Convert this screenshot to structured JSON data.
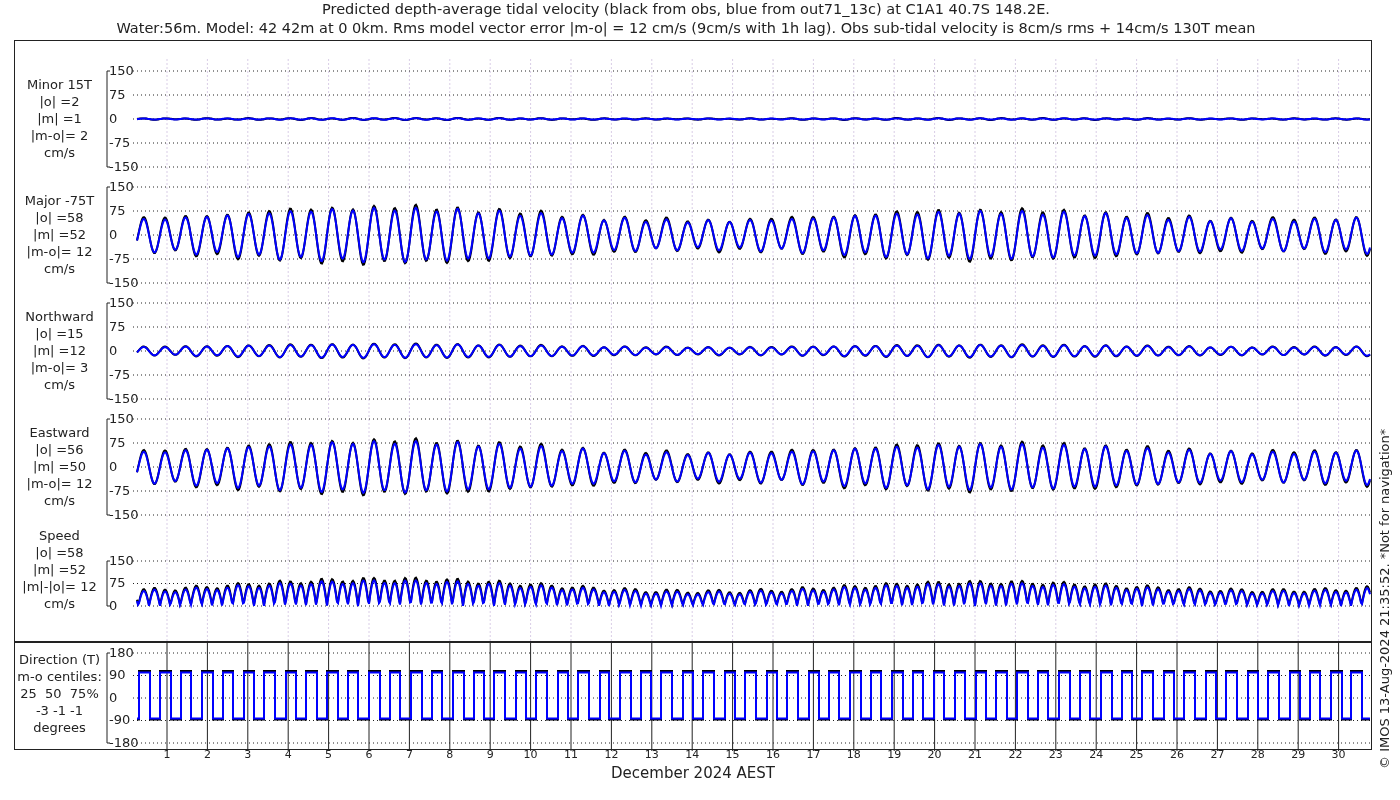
{
  "title": {
    "lines": [
      "Predicted depth-average tidal velocity (black from obs, blue from out71_13c) at C1A1 40.7S 148.2E.",
      "Water:56m. Model: 42 42m at 0 0km. Rms model vector error |m-o| = 12 cm/s (9cm/s with 1h lag). Obs sub-tidal velocity is 8cm/s rms + 14cm/s 130T mean"
    ]
  },
  "panels": [
    {
      "kind": "minor",
      "label_lines": [
        "Minor 15T",
        "|o| =2",
        "|m| =1",
        "|m-o|= 2",
        "cm/s"
      ],
      "yticks": [
        "150",
        "75",
        "0",
        "-75",
        "-150"
      ]
    },
    {
      "kind": "major",
      "label_lines": [
        "Major -75T",
        "|o| =58",
        "|m| =52",
        "|m-o|= 12",
        "cm/s"
      ],
      "yticks": [
        "150",
        "75",
        "0",
        "-75",
        "-150"
      ]
    },
    {
      "kind": "northward",
      "label_lines": [
        "Northward",
        "|o| =15",
        "|m| =12",
        "|m-o|= 3",
        "cm/s"
      ],
      "yticks": [
        "150",
        "75",
        "0",
        "-75",
        "-150"
      ]
    },
    {
      "kind": "eastward",
      "label_lines": [
        "Eastward",
        "|o| =56",
        "|m| =50",
        "|m-o|= 12",
        "cm/s"
      ],
      "yticks": [
        "150",
        "75",
        "0",
        "-75",
        "-150"
      ]
    },
    {
      "kind": "speed",
      "label_lines": [
        "Speed",
        "|o| =58",
        "|m| =52",
        "|m|-|o|= 12",
        "cm/s"
      ],
      "yticks": [
        "150",
        "75",
        "0"
      ]
    },
    {
      "kind": "direction",
      "label_lines": [
        "Direction (T)",
        "m-o centiles:",
        "25  50  75%",
        "-3 -1 -1",
        "degrees"
      ],
      "yticks": [
        "180",
        "90",
        "0",
        "-90",
        "-180"
      ]
    }
  ],
  "x_axis": {
    "days": [
      "1",
      "2",
      "3",
      "4",
      "5",
      "6",
      "7",
      "8",
      "9",
      "10",
      "11",
      "12",
      "13",
      "14",
      "15",
      "16",
      "17",
      "18",
      "19",
      "20",
      "21",
      "22",
      "23",
      "24",
      "25",
      "26",
      "27",
      "28",
      "29",
      "30"
    ],
    "xlabel": "December 2024 AEST"
  },
  "side_note": "© IMOS 13-Aug-2024 21:35:52. *Not for navigation*"
}
